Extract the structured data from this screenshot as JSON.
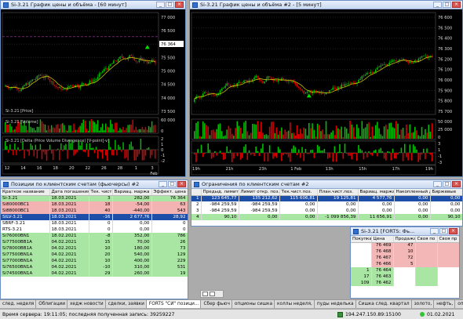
{
  "chart1": {
    "title": "Si-3.21 График цены и объёма - [60 минут]",
    "price_legend": "Si-3.21 [Price]",
    "volume_legend": "Si-3.21 [Volume]",
    "dpv_legend": "Si-3.21 [Delta (Price Volume Divergence) [V-point]-v]",
    "price_ticks": [
      "77 000",
      "76 500",
      "76 000",
      "75 500",
      "75 000",
      "74 500",
      "74 000",
      "73 500"
    ],
    "last_price": "76 364",
    "volume_ticks": [
      "60 000",
      "0"
    ],
    "dpv_ticks": [
      "2",
      "1",
      "0",
      "-1",
      "-2"
    ],
    "x_labels": [
      "12",
      "14",
      "16",
      "18",
      "20",
      "22",
      "26",
      "28",
      "1",
      "3"
    ],
    "x_month": "Feb"
  },
  "chart2": {
    "title": "Si-3.21 График цены и объёма #2 - [5 минут]",
    "price_ticks": [
      "76 600",
      "76 500",
      "76 400",
      "76 300",
      "76 200",
      "76 100",
      "76 000",
      "75 900",
      "75 800",
      "75 700"
    ],
    "volume_ticks": [
      "50 000",
      "25 000",
      "0"
    ],
    "dpv_ticks": [
      "3",
      "1",
      "-1",
      "-3"
    ],
    "x_labels": [
      "19h",
      "21h",
      "23h",
      "1 Feb",
      "13h",
      "15h",
      "17h",
      "19h"
    ]
  },
  "positions": {
    "title": "Позиции по клиентским счетам (фьючерсы) #2",
    "columns": [
      "Краткое название",
      "Дата погашения",
      "Тек. чист.",
      "Вариац. маржа",
      "Эффект. цена"
    ],
    "rows": [
      {
        "name": "Si-3.21",
        "date": "18.03.2021",
        "net": "3",
        "margin": "282,00",
        "price": "76 364",
        "tone": "g"
      },
      {
        "name": "Si80000BC1",
        "date": "18.03.2021",
        "net": "18",
        "margin": "-54,00",
        "price": "63",
        "tone": "r"
      },
      {
        "name": "Si88000BC1",
        "date": "18.03.2021",
        "net": "40",
        "margin": "-440,00",
        "price": "543",
        "tone": "r"
      },
      {
        "name": "SILV-3.21",
        "date": "18.03.2021",
        "net": "-16",
        "margin": "2 677,76",
        "price": "28,92",
        "tone": "s"
      },
      {
        "name": "SBRF-3.21",
        "date": "18.03.2021",
        "net": "0",
        "margin": "0,00",
        "price": "0",
        "tone": "w"
      },
      {
        "name": "RTS-3.21",
        "date": "18.03.2021",
        "net": "0",
        "margin": "0,00",
        "price": "0",
        "tone": "w"
      },
      {
        "name": "Si76000BN1",
        "date": "18.02.2021",
        "net": "-8",
        "margin": "352,00",
        "price": "786",
        "tone": "g"
      },
      {
        "name": "Si77500BB1A",
        "date": "04.02.2021",
        "net": "15",
        "margin": "70,00",
        "price": "26",
        "tone": "g"
      },
      {
        "name": "Si78000BB1A",
        "date": "04.02.2021",
        "net": "10",
        "margin": "180,00",
        "price": "73",
        "tone": "g"
      },
      {
        "name": "Si77500BN1A",
        "date": "04.02.2021",
        "net": "20",
        "margin": "540,00",
        "price": "129",
        "tone": "g"
      },
      {
        "name": "Si77000BN1A",
        "date": "04.02.2021",
        "net": "10",
        "margin": "400,00",
        "price": "229",
        "tone": "g"
      },
      {
        "name": "Si76500BN1A",
        "date": "04.02.2021",
        "net": "-10",
        "margin": "310,00",
        "price": "531",
        "tone": "g"
      },
      {
        "name": "Si74500BN1A",
        "date": "04.02.2021",
        "net": "29",
        "margin": "260,00",
        "price": "19",
        "tone": "g"
      }
    ]
  },
  "limits": {
    "title": "Ограничения по клиентским счетам #2",
    "columns": [
      "",
      "Предыд. лимит",
      "Лимит откр. поз.",
      "Тек.чист.поз.",
      "План.чист.поз.",
      "Вариац. маржа",
      "Накопленный доход",
      "Биржевые"
    ],
    "rows": [
      {
        "c": [
          "1",
          "123 645,77",
          "135 212,62",
          "115 606,81",
          "19 125,81",
          "4 577,76",
          "0,00",
          "0,00"
        ],
        "tone": "s"
      },
      {
        "c": [
          "2",
          "-984 259,59",
          "-984 259,59",
          "0,00",
          "0,00",
          "0,00",
          "0,00",
          "0,00"
        ],
        "tone": "w"
      },
      {
        "c": [
          "3",
          "-984 259,59",
          "-984 259,59",
          "0,00",
          "0,00",
          "0,00",
          "0,00",
          "0,00"
        ],
        "tone": "w"
      },
      {
        "c": [
          "4",
          "90,10",
          "0,00",
          "0,00",
          "-1 099 856,39",
          "11 656,91",
          "0,00",
          "90,10"
        ],
        "tone": "g"
      }
    ]
  },
  "orderbook": {
    "title": "Si-3.21 [FORTS: Фь...",
    "columns": [
      "Покупка",
      "Цена",
      "Продажа",
      "Своя по",
      "Своя пр"
    ],
    "rows": [
      {
        "buy": "",
        "price": "76 469",
        "sell": "47",
        "side": "sell"
      },
      {
        "buy": "",
        "price": "76 468",
        "sell": "10",
        "side": "sell"
      },
      {
        "buy": "",
        "price": "76 467",
        "sell": "72",
        "side": "sell"
      },
      {
        "buy": "",
        "price": "76 466",
        "sell": "5",
        "side": "sell"
      },
      {
        "buy": "1",
        "price": "76 464",
        "sell": "",
        "side": "buy"
      },
      {
        "buy": "17",
        "price": "76 463",
        "sell": "",
        "side": "buy"
      },
      {
        "buy": "109",
        "price": "76 462",
        "sell": "",
        "side": "buy"
      }
    ]
  },
  "tabs": [
    "след. неделя",
    "Облигации",
    "хедж новости",
    "сделки, заявки",
    "FORTS \"СИ\" позици...",
    "Сбер фьюч",
    "опционы сишка",
    "коллы неделя,",
    "пуды неделька",
    "Сишка след. квартал",
    "золото,",
    "нефть,",
    "опционы ртс",
    "серебро"
  ],
  "active_tab": 4,
  "status": {
    "server": "Время сервера: 19:11:05; последняя полученная запись: 39259227",
    "ip": "194.247.150.89:15100",
    "date": "01.02.2021"
  },
  "colors": {
    "chart_bg": "#000000",
    "up": "#00c000",
    "down": "#e00000",
    "ma": "#d8d800",
    "row_green": "#a9e5a3",
    "row_red": "#f3b3b3",
    "row_selected": "#1e4fa8"
  }
}
